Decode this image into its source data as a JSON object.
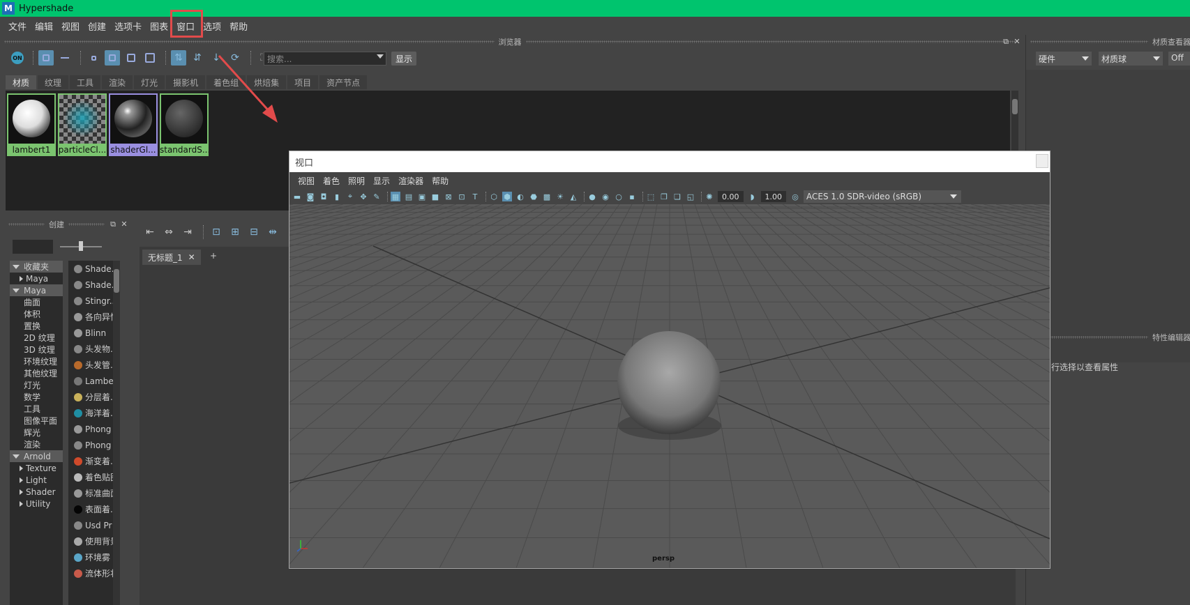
{
  "window": {
    "title": "Hypershade",
    "logo": "M"
  },
  "menubar": [
    "文件",
    "编辑",
    "视图",
    "创建",
    "选项卡",
    "图表",
    "窗口",
    "选项",
    "帮助"
  ],
  "browser": {
    "title": "浏览器",
    "search_placeholder": "搜索...",
    "show_button": "显示",
    "tabs": [
      "材质",
      "纹理",
      "工具",
      "渲染",
      "灯光",
      "摄影机",
      "着色组",
      "烘焙集",
      "项目",
      "资产节点"
    ],
    "materials": [
      "lambert1",
      "particleCl...",
      "shaderGl...",
      "standardS..."
    ]
  },
  "material_viewer": {
    "title": "材质查看器",
    "renderer": "硬件",
    "shape": "材质球",
    "off": "Off"
  },
  "property_editor": {
    "title": "特性编辑器",
    "hint": "行选择以查看属性"
  },
  "create_panel": {
    "title": "创建",
    "tree": [
      {
        "label": "收藏夹",
        "type": "hdr"
      },
      {
        "label": "Maya",
        "type": "sub"
      },
      {
        "label": "Maya",
        "type": "hdr"
      },
      {
        "label": "曲面",
        "type": "leaf"
      },
      {
        "label": "体积",
        "type": "leaf"
      },
      {
        "label": "置换",
        "type": "leaf"
      },
      {
        "label": "2D 纹理",
        "type": "leaf"
      },
      {
        "label": "3D 纹理",
        "type": "leaf"
      },
      {
        "label": "环境纹理",
        "type": "leaf"
      },
      {
        "label": "其他纹理",
        "type": "leaf"
      },
      {
        "label": "灯光",
        "type": "leaf"
      },
      {
        "label": "数学",
        "type": "leaf"
      },
      {
        "label": "工具",
        "type": "leaf"
      },
      {
        "label": "图像平面",
        "type": "leaf"
      },
      {
        "label": "辉光",
        "type": "leaf"
      },
      {
        "label": "渲染",
        "type": "leaf"
      },
      {
        "label": "Arnold",
        "type": "hdr"
      },
      {
        "label": "Texture",
        "type": "sub"
      },
      {
        "label": "Light",
        "type": "sub"
      },
      {
        "label": "Shader",
        "type": "sub"
      },
      {
        "label": "Utility",
        "type": "sub"
      }
    ],
    "shaders": [
      {
        "label": "Shade...",
        "color": "#888"
      },
      {
        "label": "Shade...",
        "color": "#888"
      },
      {
        "label": "Stingr...",
        "color": "#888"
      },
      {
        "label": "各向异性",
        "color": "#999"
      },
      {
        "label": "Blinn",
        "color": "#999"
      },
      {
        "label": "头发物...",
        "color": "#888"
      },
      {
        "label": "头发管...",
        "color": "#b86a2b"
      },
      {
        "label": "Lambert",
        "color": "#777"
      },
      {
        "label": "分层着...",
        "color": "#c9b15a"
      },
      {
        "label": "海洋着...",
        "color": "#1f8ea3"
      },
      {
        "label": "Phong",
        "color": "#999"
      },
      {
        "label": "Phong",
        "color": "#888"
      },
      {
        "label": "渐变着...",
        "color": "#d04a2b"
      },
      {
        "label": "着色贴图",
        "color": "#bbb"
      },
      {
        "label": "标准曲面",
        "color": "#999"
      },
      {
        "label": "表面着...",
        "color": "#050505"
      },
      {
        "label": "Usd Pr",
        "color": "#888"
      },
      {
        "label": "使用背景",
        "color": "#aaa"
      },
      {
        "label": "环境雾",
        "color": "#5aa6c8"
      },
      {
        "label": "流体形状",
        "color": "#c85a4a"
      }
    ]
  },
  "graph": {
    "tab": "无标题_1",
    "add_tab": "+"
  },
  "viewport": {
    "title": "视口",
    "menus": [
      "视图",
      "着色",
      "照明",
      "显示",
      "渲染器",
      "帮助"
    ],
    "exposure": "0.00",
    "gamma": "1.00",
    "colorspace": "ACES 1.0 SDR-video (sRGB)",
    "camera": "persp"
  }
}
